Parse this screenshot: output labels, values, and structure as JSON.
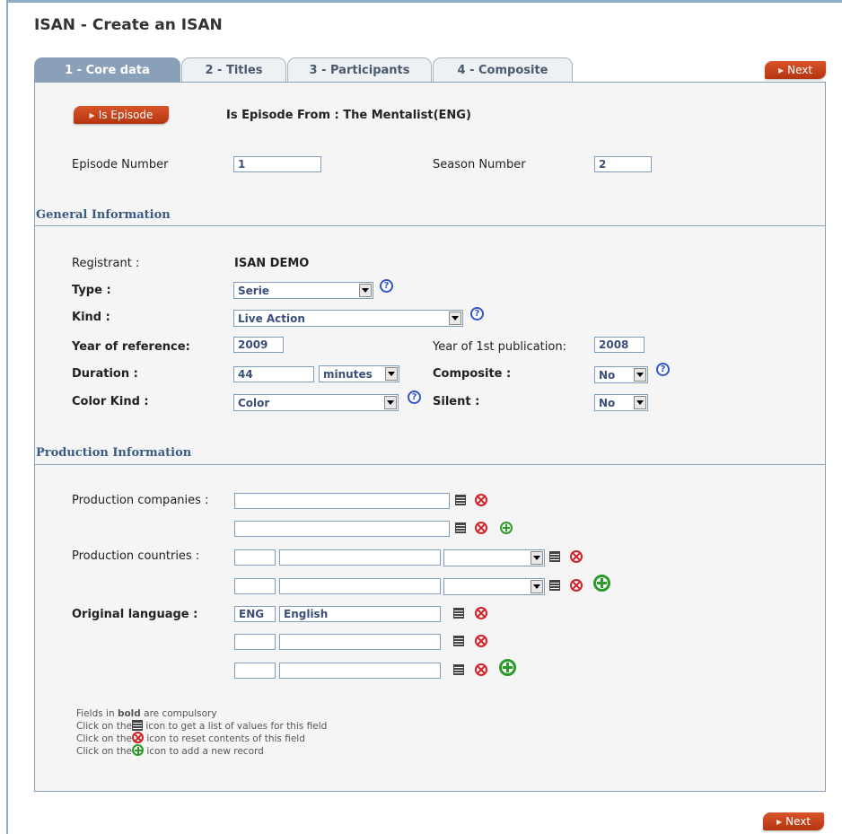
{
  "page": {
    "title": "ISAN - Create an ISAN"
  },
  "tabs": [
    {
      "label": "1 - Core data",
      "active": true
    },
    {
      "label": "2 - Titles",
      "active": false
    },
    {
      "label": "3 - Participants",
      "active": false
    },
    {
      "label": "4 - Composite",
      "active": false
    }
  ],
  "buttons": {
    "next": "Next",
    "is_episode": "Is Episode"
  },
  "episode": {
    "from_text": "Is Episode From :  The Mentalist(ENG)",
    "episode_number_label": "Episode Number",
    "episode_number_value": "1",
    "season_number_label": "Season Number",
    "season_number_value": "2"
  },
  "general": {
    "heading": "General Information",
    "registrant_label": "Registrant :",
    "registrant_value": "ISAN DEMO",
    "type_label": "Type :",
    "type_value": "Serie",
    "kind_label": "Kind :",
    "kind_value": "Live Action",
    "year_ref_label": "Year of reference:",
    "year_ref_value": "2009",
    "year_pub_label": "Year of 1st publication:",
    "year_pub_value": "2008",
    "duration_label": "Duration :",
    "duration_value": "44",
    "duration_unit": "minutes",
    "composite_label": "Composite :",
    "composite_value": "No",
    "color_kind_label": "Color Kind :",
    "color_kind_value": "Color",
    "silent_label": "Silent :",
    "silent_value": "No",
    "help_glyph": "?"
  },
  "production": {
    "heading": "Production Information",
    "companies_label": "Production companies :",
    "countries_label": "Production countries :",
    "language_label": "Original language :",
    "language_rows": [
      {
        "code": "ENG",
        "name": "English"
      },
      {
        "code": "",
        "name": ""
      },
      {
        "code": "",
        "name": ""
      }
    ]
  },
  "legend": {
    "line1_pre": "Fields in ",
    "line1_bold": "bold",
    "line1_post": " are compulsory",
    "line2_pre": "Click on the",
    "line2_post": " icon to get a list of values for this field",
    "line3_pre": "Click on the",
    "line3_post": " icon to reset contents of this field",
    "line4_pre": "Click on the",
    "line4_post": " icon to add a new record"
  },
  "colors": {
    "accent_orange": "#c4451a",
    "tab_active": "#8aa0b8",
    "section_text": "#3a5a82"
  }
}
